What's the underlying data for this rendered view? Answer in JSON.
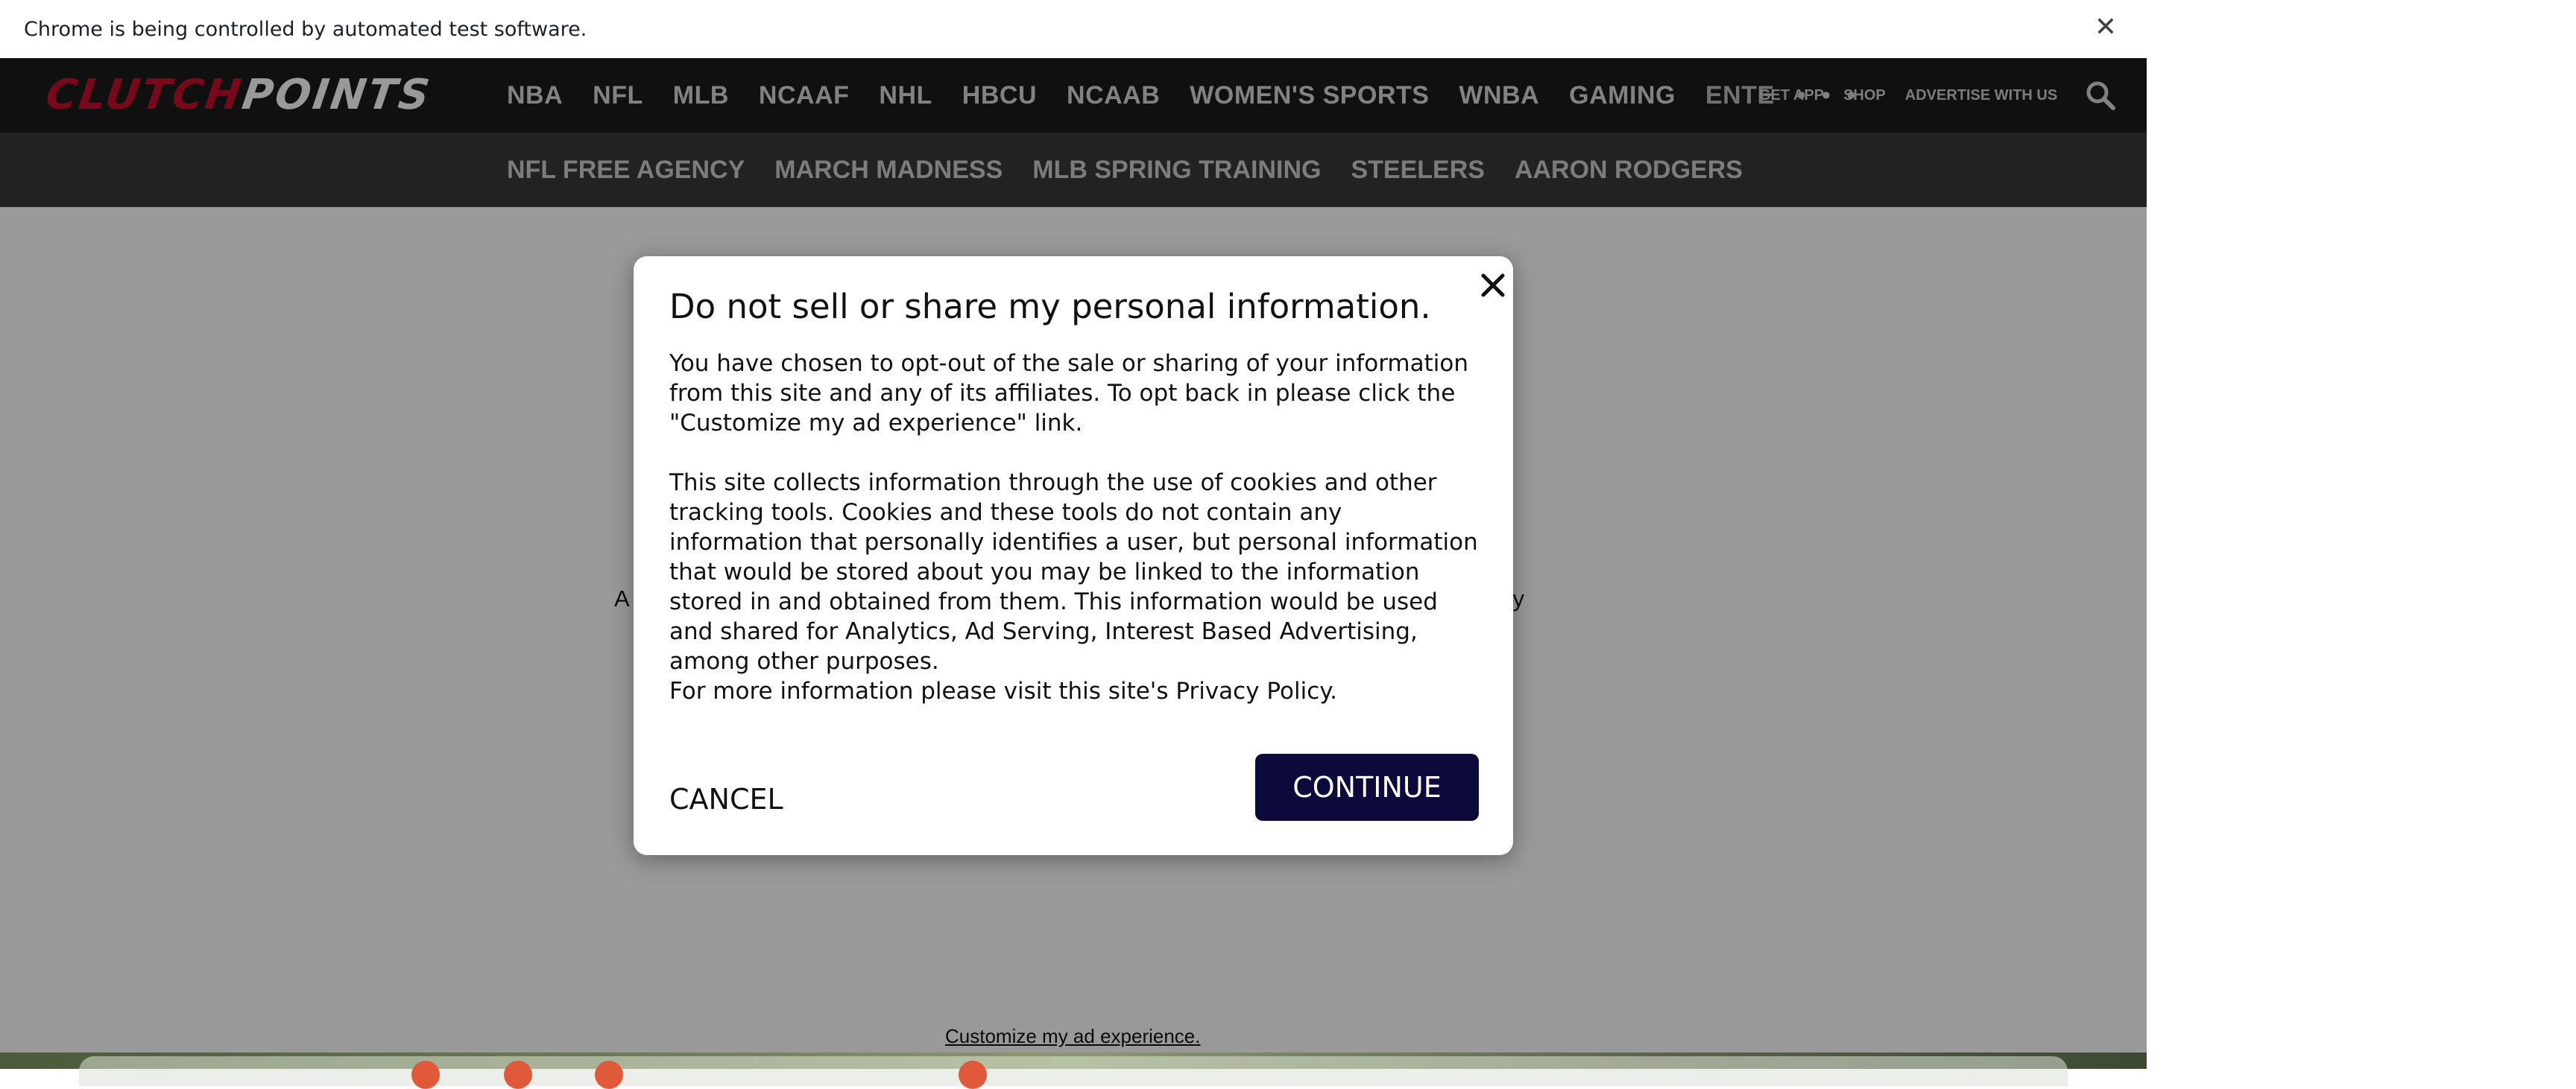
{
  "browser": {
    "infobar_text": "Chrome is being controlled by automated test software.",
    "infobar_close": "✕"
  },
  "site": {
    "logo_part1": "CLUTCH",
    "logo_part2": "POINTS",
    "nav_items": [
      "NBA",
      "NFL",
      "MLB",
      "NCAAF",
      "NHL",
      "HBCU",
      "NCAAB",
      "WOMEN'S SPORTS",
      "WNBA",
      "GAMING",
      "ENTE"
    ],
    "nav_more": "• • •",
    "utility_links": [
      "GET APP",
      "SHOP",
      "ADVERTISE WITH US"
    ],
    "sub_nav_items": [
      "NFL FREE AGENCY",
      "MARCH MADNESS",
      "MLB SPRING TRAINING",
      "STEELERS",
      "AARON RODGERS"
    ],
    "bg_fragment_left": "A",
    "bg_fragment_right": "cy",
    "customize_link": "Customize my ad experience."
  },
  "modal": {
    "title": "Do not sell or share my personal information.",
    "close_icon": "close-icon",
    "paragraph1": "You have chosen to opt-out of the sale or sharing of your information from this site and any of its affiliates. To opt back in please click the \"Customize my ad experience\" link.",
    "paragraph2": "This site collects information through the use of cookies and other tracking tools. Cookies and these tools do not contain any information that personally identifies a user, but personal information that would be stored about you may be linked to the information stored in and obtained from them. This information would be used and shared for Analytics, Ad Serving, Interest Based Advertising, among other purposes.",
    "paragraph3": "For more information please visit this site's Privacy Policy.",
    "cancel_label": "CANCEL",
    "continue_label": "CONTINUE"
  },
  "colors": {
    "brand_red": "#c8102e",
    "nav_bg": "#1b1b1b",
    "subnav_bg": "#3a3a3a",
    "continue_bg": "#0b0a3a"
  }
}
